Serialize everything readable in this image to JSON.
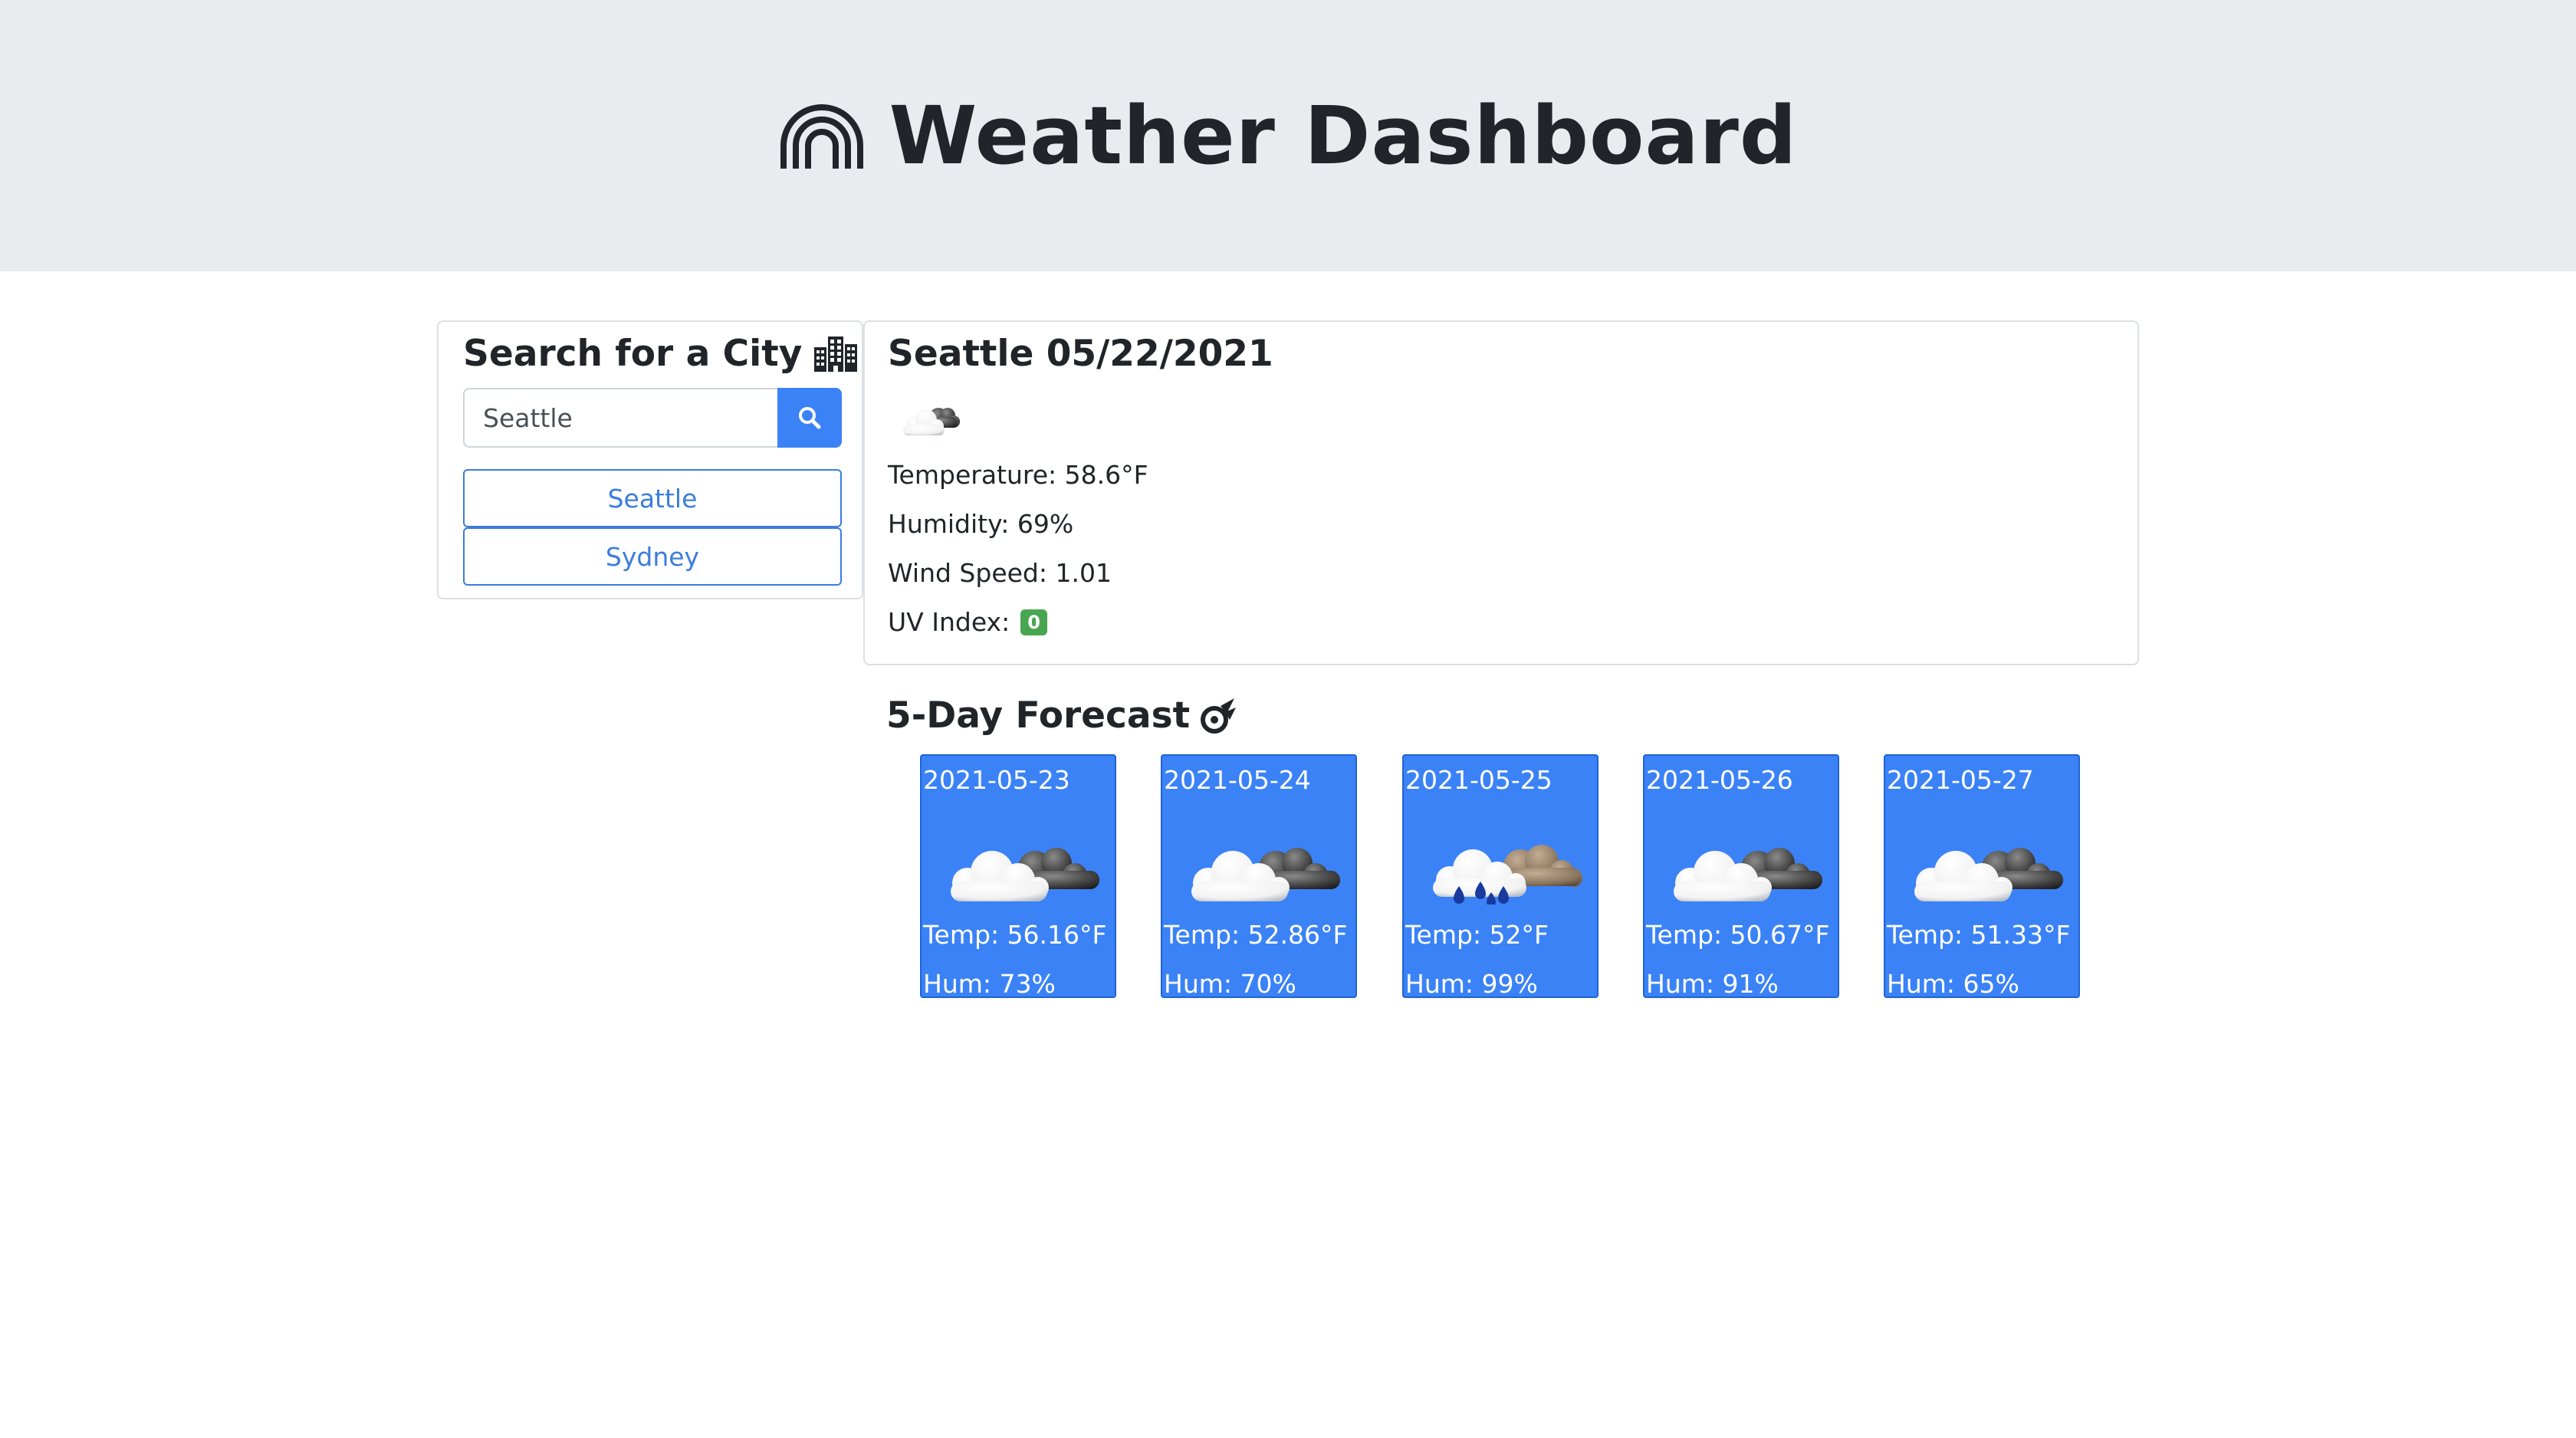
{
  "header": {
    "title": "Weather Dashboard",
    "icon": "rainbow-icon"
  },
  "search": {
    "title": "Search for a City",
    "title_icon": "city-icon",
    "input_value": "Seattle",
    "button_icon": "search-icon",
    "history": [
      "Seattle",
      "Sydney"
    ]
  },
  "current": {
    "title": "Seattle 05/22/2021",
    "icon": "cloudy-icon",
    "temperature": "Temperature: 58.6°F",
    "humidity": "Humidity: 69%",
    "wind": "Wind Speed: 1.01",
    "uv_label": "UV Index:",
    "uv_value": "0",
    "uv_color": "#49a650"
  },
  "forecast": {
    "title": "5-Day Forecast",
    "title_icon": "meteor-icon",
    "card_color": "#3b82f6",
    "days": [
      {
        "date": "2021-05-23",
        "icon": "broken-clouds-icon",
        "temp": "Temp: 56.16°F",
        "hum": "Hum: 73%"
      },
      {
        "date": "2021-05-24",
        "icon": "broken-clouds-icon",
        "temp": "Temp: 52.86°F",
        "hum": "Hum: 70%"
      },
      {
        "date": "2021-05-25",
        "icon": "rain-icon",
        "temp": "Temp: 52°F",
        "hum": "Hum: 99%"
      },
      {
        "date": "2021-05-26",
        "icon": "broken-clouds-icon",
        "temp": "Temp: 50.67°F",
        "hum": "Hum: 91%"
      },
      {
        "date": "2021-05-27",
        "icon": "broken-clouds-icon",
        "temp": "Temp: 51.33°F",
        "hum": "Hum: 65%"
      }
    ]
  }
}
